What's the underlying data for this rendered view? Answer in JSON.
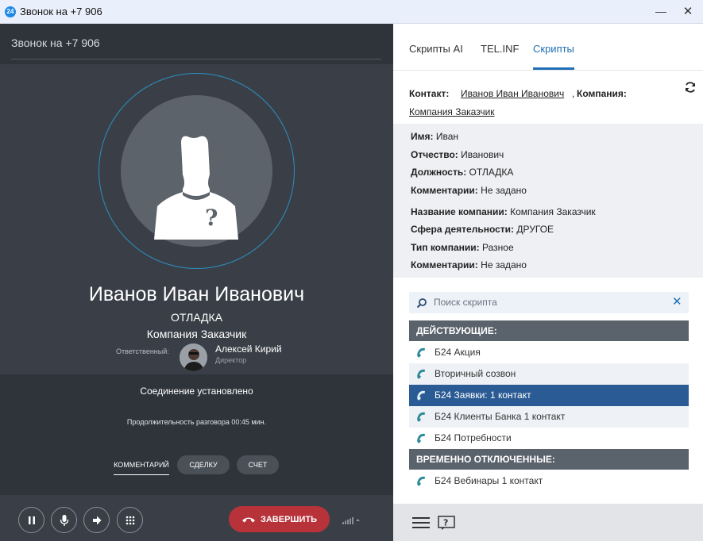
{
  "window": {
    "title": "Звонок на +7 906",
    "icon_text": "24",
    "minimize": "—",
    "close": "✕"
  },
  "call": {
    "header": "Звонок на +7 906",
    "caller_name": "Иванов Иван Иванович",
    "caller_post": "ОТЛАДКА",
    "caller_company": "Компания Заказчик",
    "responsible_label": "Ответственный:",
    "responsible_name": "Алексей Кирий",
    "responsible_role": "Директор",
    "status": "Соединение установлено",
    "duration": "Продолжительность разговора 00:45 мин.",
    "tabs": {
      "comment": "КОММЕНТАРИЙ",
      "deal": "СДЕЛКУ",
      "check": "СЧЕТ"
    },
    "end_button": "ЗАВЕРШИТЬ"
  },
  "panel": {
    "tabs": [
      "Скрипты AI",
      "TEL.INF",
      "Скрипты"
    ],
    "active_tab": "Скрипты",
    "contact_label": "Контакт:",
    "contact_name": "Иванов Иван Иванович",
    "comma": ",",
    "company_label": "Компания:",
    "company_name": "Компания Заказчик",
    "info": [
      {
        "label": "Имя:",
        "value": "Иван"
      },
      {
        "label": "Отчество:",
        "value": "Иванович"
      },
      {
        "label": "Должность:",
        "value": "ОТЛАДКА"
      },
      {
        "label": "Комментарии:",
        "value": "Не задано"
      },
      {
        "label": "Название компании:",
        "value": "Компания Заказчик"
      },
      {
        "label": "Сфера деятельности:",
        "value": "ДРУГОЕ"
      },
      {
        "label": "Тип компании:",
        "value": "Разное"
      },
      {
        "label": "Комментарии:",
        "value": "Не задано"
      }
    ],
    "search_placeholder": "Поиск скрипта",
    "active_header": "ДЕЙСТВУЮЩИЕ:",
    "active_scripts": [
      "Б24 Акция",
      "Вторичный созвон",
      "Б24 Заявки: 1 контакт",
      "Б24 Клиенты Банка 1 контакт",
      "Б24 Потребности"
    ],
    "selected_script": "Б24 Заявки: 1 контакт",
    "disabled_header": "ВРЕМЕННО ОТКЛЮЧЕННЫЕ:",
    "disabled_scripts": [
      "Б24 Вебинары 1 контакт"
    ]
  },
  "colors": {
    "accent": "#1e6fb5",
    "end_call": "#b8323a",
    "selected_row": "#2b5b94",
    "dark_bg": "#3a3f47",
    "ring": "#2c8fc0"
  },
  "icons": [
    "app-icon",
    "person-silhouette-icon",
    "pause-icon",
    "microphone-icon",
    "transfer-icon",
    "keypad-icon",
    "phone-hangup-icon",
    "signal-icon",
    "refresh-icon",
    "search-icon",
    "close-icon",
    "phone-icon",
    "menu-icon",
    "help-icon"
  ]
}
